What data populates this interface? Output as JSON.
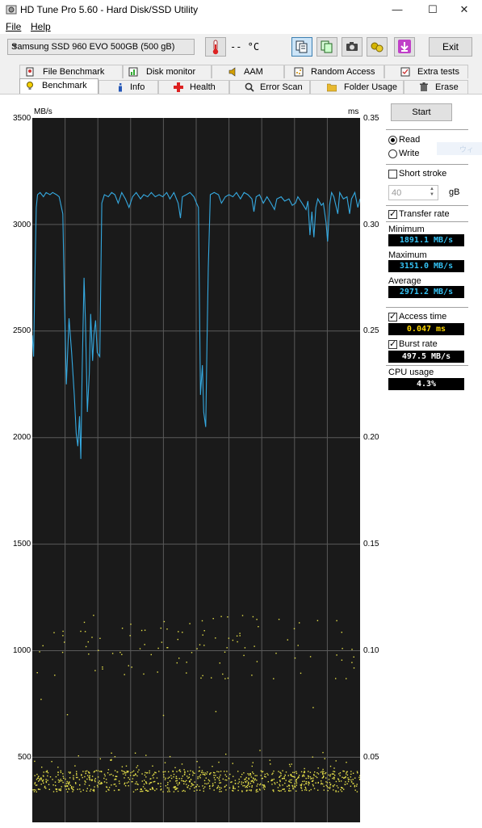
{
  "window": {
    "title": "HD Tune Pro 5.60 - Hard Disk/SSD Utility",
    "minimize": "—",
    "maximize": "☐",
    "close": "✕"
  },
  "menu": {
    "file": "File",
    "help": "Help"
  },
  "toolbar": {
    "drive": "Samsung SSD 960 EVO 500GB (500 gB)",
    "temperature": "-- °C",
    "exit": "Exit"
  },
  "tabs": {
    "row1": [
      "File Benchmark",
      "Disk monitor",
      "AAM",
      "Random Access",
      "Extra tests"
    ],
    "row2": [
      "Benchmark",
      "Info",
      "Health",
      "Error Scan",
      "Folder Usage",
      "Erase"
    ]
  },
  "chart_data": {
    "type": "line",
    "left_unit": "MB/s",
    "right_unit": "ms",
    "left_ticks": [
      "3500",
      "3000",
      "2500",
      "2000",
      "1500",
      "1000",
      "500"
    ],
    "right_ticks": [
      "0.35",
      "0.30",
      "0.25",
      "0.20",
      "0.15",
      "0.10",
      "0.05"
    ],
    "ylim_left": [
      0,
      3500
    ],
    "ylim_right": [
      0,
      0.35
    ],
    "x_range": [
      0,
      100
    ],
    "series": [
      {
        "color": "#35a9e0",
        "points": [
          [
            0,
            2480
          ],
          [
            0.4,
            2380
          ],
          [
            0.8,
            2750
          ],
          [
            1.2,
            3080
          ],
          [
            1.6,
            3140
          ],
          [
            2.4,
            3150
          ],
          [
            3.4,
            3130
          ],
          [
            4.2,
            3150
          ],
          [
            5.4,
            3140
          ],
          [
            6.2,
            3150
          ],
          [
            7.4,
            3140
          ],
          [
            8.2,
            3130
          ],
          [
            9.3,
            3050
          ],
          [
            9.8,
            2650
          ],
          [
            10.4,
            2250
          ],
          [
            11.2,
            2560
          ],
          [
            12,
            2400
          ],
          [
            12.8,
            2200
          ],
          [
            13.4,
            2020
          ],
          [
            13.9,
            1960
          ],
          [
            14.4,
            2100
          ],
          [
            14.8,
            1900
          ],
          [
            15.2,
            2300
          ],
          [
            15.8,
            2750
          ],
          [
            16.2,
            2550
          ],
          [
            16.8,
            2120
          ],
          [
            17.4,
            2300
          ],
          [
            17.8,
            2580
          ],
          [
            18.4,
            2360
          ],
          [
            18.8,
            2480
          ],
          [
            19.3,
            2550
          ],
          [
            19.8,
            2400
          ],
          [
            20.6,
            2380
          ],
          [
            21.2,
            3100
          ],
          [
            22,
            3140
          ],
          [
            23.2,
            3130
          ],
          [
            24.2,
            3150
          ],
          [
            25.2,
            3140
          ],
          [
            26.2,
            3100
          ],
          [
            27.3,
            3150
          ],
          [
            28.4,
            3120
          ],
          [
            29.5,
            3080
          ],
          [
            30.6,
            3130
          ],
          [
            31.7,
            3150
          ],
          [
            33,
            3120
          ],
          [
            34,
            3140
          ],
          [
            35.2,
            3130
          ],
          [
            36.3,
            3150
          ],
          [
            37.5,
            3130
          ],
          [
            38.7,
            3140
          ],
          [
            39.8,
            3130
          ],
          [
            41,
            3150
          ],
          [
            42,
            3120
          ],
          [
            43.2,
            3150
          ],
          [
            44.5,
            3100
          ],
          [
            45.2,
            3030
          ],
          [
            45.8,
            3130
          ],
          [
            47,
            3140
          ],
          [
            48.1,
            3150
          ],
          [
            49.3,
            3130
          ],
          [
            50.1,
            3100
          ],
          [
            50.7,
            3080
          ],
          [
            51.3,
            2200
          ],
          [
            51.9,
            2340
          ],
          [
            52.3,
            2120
          ],
          [
            52.9,
            2050
          ],
          [
            53.3,
            2450
          ],
          [
            53.7,
            2800
          ],
          [
            54.3,
            3140
          ],
          [
            55.5,
            3150
          ],
          [
            56.8,
            3140
          ],
          [
            57.7,
            3100
          ],
          [
            58.9,
            3130
          ],
          [
            60,
            3140
          ],
          [
            61.2,
            3130
          ],
          [
            62.3,
            3150
          ],
          [
            63.5,
            3120
          ],
          [
            64.6,
            3150
          ],
          [
            65.8,
            3140
          ],
          [
            67,
            3120
          ],
          [
            67.6,
            3060
          ],
          [
            68.3,
            3130
          ],
          [
            69.3,
            3140
          ],
          [
            70.5,
            3100
          ],
          [
            71.6,
            3130
          ],
          [
            72.8,
            3100
          ],
          [
            73.9,
            3070
          ],
          [
            74.6,
            3120
          ],
          [
            75.9,
            3130
          ],
          [
            77,
            3110
          ],
          [
            78.3,
            3120
          ],
          [
            79.3,
            3090
          ],
          [
            80.3,
            3100
          ],
          [
            81,
            3130
          ],
          [
            82.3,
            3100
          ],
          [
            83.5,
            3070
          ],
          [
            84.1,
            3110
          ],
          [
            84.7,
            2950
          ],
          [
            85.3,
            3060
          ],
          [
            85.9,
            2940
          ],
          [
            86.5,
            3080
          ],
          [
            87.1,
            3120
          ],
          [
            88.2,
            3090
          ],
          [
            88.8,
            3100
          ],
          [
            89.6,
            3010
          ],
          [
            90.1,
            2920
          ],
          [
            90.7,
            3090
          ],
          [
            91.3,
            3150
          ],
          [
            92,
            3130
          ],
          [
            93.2,
            3050
          ],
          [
            93.8,
            3150
          ],
          [
            94.9,
            3120
          ],
          [
            96,
            3130
          ],
          [
            96.8,
            3050
          ],
          [
            97.4,
            3120
          ],
          [
            98.4,
            3150
          ],
          [
            99.3,
            3080
          ],
          [
            100,
            3120
          ]
        ]
      }
    ]
  },
  "controls": {
    "start": "Start",
    "read": "Read",
    "write": "Write",
    "short_stroke": "Short stroke",
    "stroke_value": "40",
    "stroke_unit": "gB",
    "transfer_rate": "Transfer rate",
    "minimum_label": "Minimum",
    "minimum_value": "1891.1 MB/s",
    "maximum_label": "Maximum",
    "maximum_value": "3151.0 MB/s",
    "average_label": "Average",
    "average_value": "2971.2 MB/s",
    "access_time_label": "Access time",
    "access_time_value": "0.047 ms",
    "burst_rate_label": "Burst rate",
    "burst_rate_value": "497.5 MB/s",
    "cpu_usage_label": "CPU usage",
    "cpu_usage_value": "4.3%",
    "ghost_text": "ウィ"
  },
  "colors": {
    "graph_bg": "#1a1a1a",
    "grid": "#5a5a5a",
    "transfer_line": "#35a9e0",
    "access_dots": "#e6e04a"
  }
}
